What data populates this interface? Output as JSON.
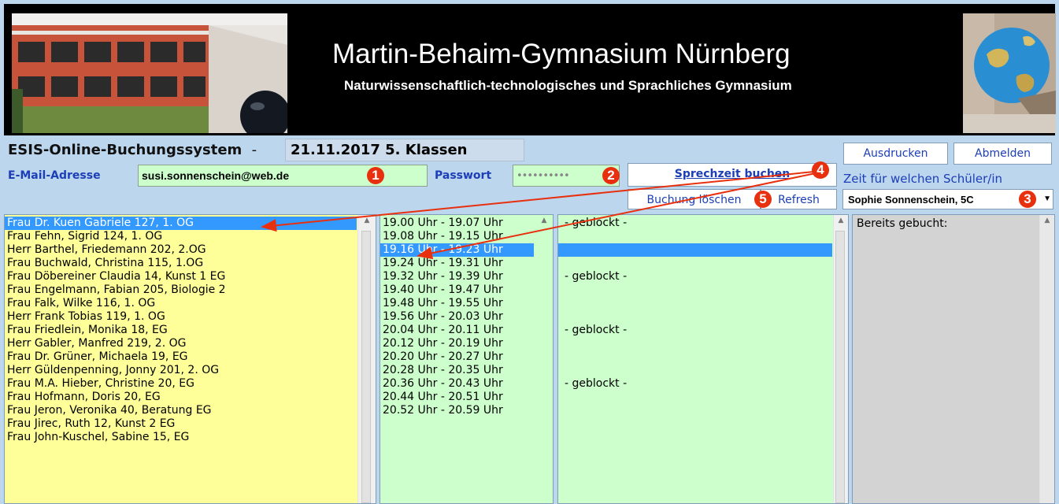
{
  "header": {
    "title": "Martin-Behaim-Gymnasium Nürnberg",
    "subtitle": "Naturwissenschaftlich-technologisches und Sprachliches Gymnasium"
  },
  "booking": {
    "system_title": "ESIS-Online-Buchungssystem",
    "separator": "-",
    "date_info": "21.11.2017  5. Klassen"
  },
  "login": {
    "email_label": "E-Mail-Adresse",
    "email_value": "susi.sonnenschein@web.de",
    "password_label": "Passwort",
    "password_value": "••••••••••"
  },
  "buttons": {
    "book": "Sprechzeit buchen",
    "print": "Ausdrucken",
    "logout": "Abmelden",
    "delete": "Buchung löschen",
    "refresh": "Refresh"
  },
  "student": {
    "label": "Zeit für welchen Schüler/in",
    "selected": "Sophie Sonnenschein, 5C"
  },
  "markers": [
    "1",
    "2",
    "3",
    "4",
    "5"
  ],
  "teachers": [
    "Frau Dr. Kuen Gabriele 127, 1. OG",
    "Frau Fehn, Sigrid 124, 1. OG",
    "Herr Barthel, Friedemann 202, 2.OG",
    "Frau Buchwald, Christina 115, 1.OG",
    "Frau Döbereiner Claudia 14, Kunst 1 EG",
    "Frau Engelmann, Fabian 205, Biologie 2",
    "Frau Falk, Wilke 116, 1. OG",
    "Herr Frank Tobias 119, 1. OG",
    "Frau Friedlein, Monika 18, EG",
    "Herr Gabler, Manfred 219, 2. OG",
    "Frau Dr. Grüner, Michaela 19, EG",
    "Herr Güldenpenning, Jonny 201, 2. OG",
    "Frau M.A. Hieber, Christine 20, EG",
    "Frau Hofmann, Doris 20, EG",
    "Frau Jeron, Veronika 40, Beratung EG",
    "Frau Jirec, Ruth 12, Kunst 2 EG",
    "Frau John-Kuschel, Sabine 15, EG"
  ],
  "slots": [
    "19.00 Uhr - 19.07 Uhr",
    "19.08 Uhr - 19.15 Uhr",
    "19.16 Uhr - 19.23 Uhr",
    "19.24 Uhr - 19.31 Uhr",
    "19.32 Uhr - 19.39 Uhr",
    "19.40 Uhr - 19.47 Uhr",
    "19.48 Uhr - 19.55 Uhr",
    "19.56 Uhr - 20.03 Uhr",
    "20.04 Uhr - 20.11 Uhr",
    "20.12 Uhr - 20.19 Uhr",
    "20.20 Uhr - 20.27 Uhr",
    "20.28 Uhr - 20.35 Uhr",
    "20.36 Uhr - 20.43 Uhr",
    "20.44 Uhr - 20.51 Uhr",
    "20.52 Uhr - 20.59 Uhr"
  ],
  "status": [
    "- geblockt -",
    "",
    "",
    "",
    "- geblockt -",
    "",
    "",
    "",
    "- geblockt -",
    "",
    "",
    "",
    "- geblockt -",
    "",
    ""
  ],
  "booked": {
    "title": "Bereits gebucht:"
  },
  "colors": {
    "accent": "#1c3eb6",
    "marker": "#e8300f",
    "selection": "#3399ff",
    "teacher_bg": "#ffff99",
    "slot_bg": "#ccffcc"
  }
}
